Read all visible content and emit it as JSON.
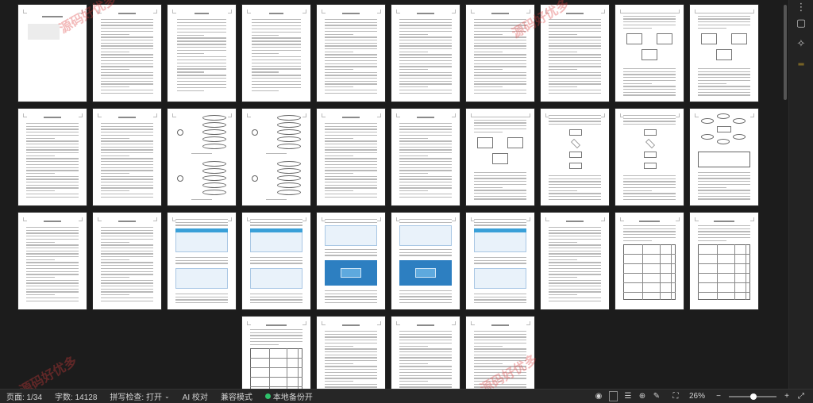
{
  "statusbar": {
    "page": "页面: 1/34",
    "words": "字数: 14128",
    "spell": "拼写检查: 打开",
    "ai": "AI 校对",
    "compat": "兼容模式",
    "backup": "本地备份开",
    "zoom": "26%",
    "zoom_level": 0.26,
    "zoom_minus": "−",
    "zoom_plus": "+"
  },
  "watermark_text": "源码好优多",
  "pages": [
    {
      "n": 1,
      "kind": "cover"
    },
    {
      "n": 2,
      "kind": "text"
    },
    {
      "n": 3,
      "kind": "toc"
    },
    {
      "n": 4,
      "kind": "toc"
    },
    {
      "n": 5,
      "kind": "text"
    },
    {
      "n": 6,
      "kind": "text"
    },
    {
      "n": 7,
      "kind": "text"
    },
    {
      "n": 8,
      "kind": "text"
    },
    {
      "n": 9,
      "kind": "diagram"
    },
    {
      "n": 10,
      "kind": "diagram"
    },
    {
      "n": 11,
      "kind": "text"
    },
    {
      "n": 12,
      "kind": "text"
    },
    {
      "n": 13,
      "kind": "usecase"
    },
    {
      "n": 14,
      "kind": "usecase"
    },
    {
      "n": 15,
      "kind": "text"
    },
    {
      "n": 16,
      "kind": "text"
    },
    {
      "n": 17,
      "kind": "diagram"
    },
    {
      "n": 18,
      "kind": "flow"
    },
    {
      "n": 19,
      "kind": "flow"
    },
    {
      "n": 20,
      "kind": "er"
    },
    {
      "n": 21,
      "kind": "text"
    },
    {
      "n": 22,
      "kind": "text"
    },
    {
      "n": 23,
      "kind": "screens"
    },
    {
      "n": 24,
      "kind": "screens"
    },
    {
      "n": 25,
      "kind": "screensblue"
    },
    {
      "n": 26,
      "kind": "screensblue"
    },
    {
      "n": 27,
      "kind": "screens"
    },
    {
      "n": 28,
      "kind": "text"
    },
    {
      "n": 29,
      "kind": "table"
    },
    {
      "n": 30,
      "kind": "table"
    },
    {
      "n": 31,
      "kind": "table"
    },
    {
      "n": 32,
      "kind": "text"
    },
    {
      "n": 33,
      "kind": "text"
    },
    {
      "n": 34,
      "kind": "text"
    }
  ],
  "colors": {
    "accent": "#2ec26b",
    "page": "#ffffff",
    "bg": "#1c1c1c"
  }
}
